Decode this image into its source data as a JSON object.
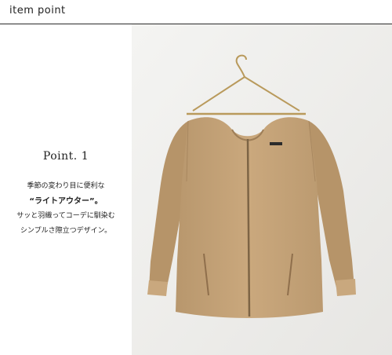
{
  "header": {
    "title": "item point"
  },
  "point": {
    "title": "Point. 1",
    "lines": [
      "季節の変わり目に便利な",
      "“ライトアウター”。",
      "サッと羽織ってコーデに馴染む",
      "シンプルさ際立つデザイン。"
    ]
  },
  "photo": {
    "subject": "jacket-on-hanger",
    "colors": {
      "wall": "#efefed",
      "jacket": "#c6a47a",
      "jacket_shadow": "#a98760",
      "hanger": "#b99a5c",
      "zipper": "#7d6445"
    }
  }
}
